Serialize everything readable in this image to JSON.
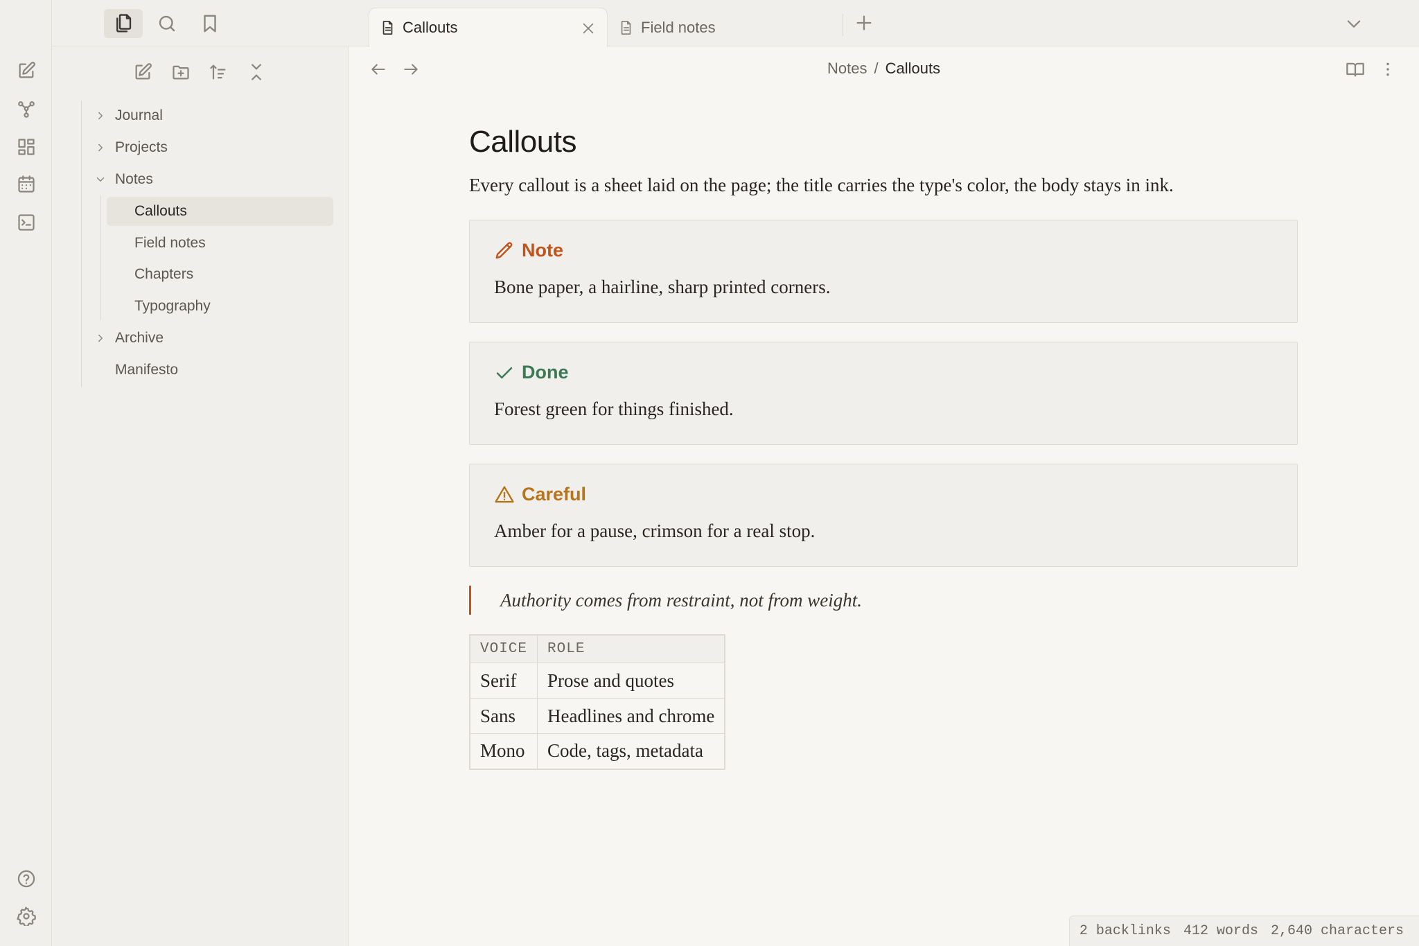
{
  "sidebar_tabs": [
    {
      "name": "files-icon",
      "active": true
    },
    {
      "name": "search-icon",
      "active": false
    },
    {
      "name": "bookmark-icon",
      "active": false
    }
  ],
  "ribbon": {
    "top": [
      "new-note-icon",
      "graph-icon",
      "canvas-icon",
      "calendar-icon",
      "terminal-icon"
    ],
    "bottom": [
      "help-icon",
      "settings-icon"
    ]
  },
  "file_actions": [
    "new-note-icon",
    "new-folder-icon",
    "sort-icon",
    "collapse-all-icon"
  ],
  "tree": {
    "journal": "Journal",
    "projects": "Projects",
    "notes": "Notes",
    "callouts": "Callouts",
    "field_notes": "Field notes",
    "chapters": "Chapters",
    "typography": "Typography",
    "archive": "Archive",
    "manifesto": "Manifesto"
  },
  "tabs": {
    "active": "Callouts",
    "second": "Field notes"
  },
  "breadcrumb": {
    "parent": "Notes",
    "separator": "/",
    "current": "Callouts"
  },
  "doc": {
    "title": "Callouts",
    "lead": "Every callout is a sheet laid on the page; the title carries the type's color, the body stays in ink.",
    "callouts": [
      {
        "title": "Note",
        "body": "Bone paper, a hairline, sharp printed corners.",
        "color": "#c1541c",
        "icon": "pencil-icon"
      },
      {
        "title": "Done",
        "body": "Forest green for things finished.",
        "color": "#3c7a56",
        "icon": "check-icon"
      },
      {
        "title": "Careful",
        "body": "Amber for a pause, crimson for a real stop.",
        "color": "#b5741e",
        "icon": "warning-icon"
      }
    ],
    "quote": "Authority comes from restraint, not from weight.",
    "table": {
      "headers": [
        "VOICE",
        "ROLE"
      ],
      "rows": [
        [
          "Serif",
          "Prose and quotes"
        ],
        [
          "Sans",
          "Headlines and chrome"
        ],
        [
          "Mono",
          "Code, tags, metadata"
        ]
      ]
    }
  },
  "status": {
    "backlinks": "2 backlinks",
    "words": "412 words",
    "characters": "2,640 characters"
  },
  "colors": {
    "accent": "#c1541c",
    "paper": "#f7f6f3",
    "panel": "#f1efeb"
  }
}
